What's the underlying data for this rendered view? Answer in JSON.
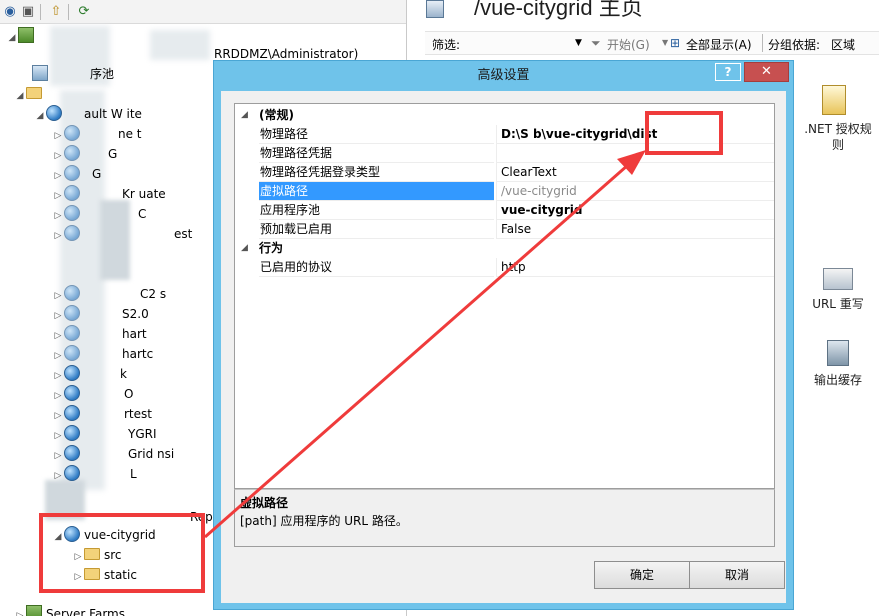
{
  "left_tree": {
    "connection_label": "RRDDMZ\\Administrator)",
    "app_pools_label": "序池",
    "default_site_label": "ault W      ite",
    "fragments": [
      "ne     t",
      "G",
      "Kr      uate",
      "C",
      "est",
      "C2      s",
      "S2.0",
      "hart",
      "hartc",
      "k",
      "O",
      "rtest",
      "YGRI",
      "Grid   nsi",
      "L"
    ],
    "selected_site": "vue-citygrid",
    "children": [
      "src",
      "static"
    ],
    "below_label": "Server Farms",
    "tail_label": "Rep"
  },
  "right_pane": {
    "title": "/vue-citygrid 主页",
    "filter_label": "筛选:",
    "start_button": "开始(G)",
    "show_all_button": "全部显示(A)",
    "group_by_label": "分组依据:",
    "group_by_value": "区域",
    "features": [
      {
        "label": ".NET 授权规则",
        "icon": "lock-document-icon"
      },
      {
        "label": "URL 重写",
        "icon": "url-rewrite-icon"
      },
      {
        "label": "输出缓存",
        "icon": "output-cache-icon"
      }
    ]
  },
  "dialog": {
    "title": "高级设置",
    "help_label": "?",
    "close_label": "✕",
    "categories": [
      {
        "name": "(常规)",
        "properties": [
          {
            "name": "物理路径",
            "value": "D:\\S          b\\vue-citygrid\\dist",
            "style": "bold"
          },
          {
            "name": "物理路径凭据",
            "value": "",
            "style": "normal"
          },
          {
            "name": "物理路径凭据登录类型",
            "value": "ClearText",
            "style": "normal"
          },
          {
            "name": "虚拟路径",
            "value": "/vue-citygrid",
            "style": "dim",
            "selected": true
          },
          {
            "name": "应用程序池",
            "value": "vue-citygrid",
            "style": "bold"
          },
          {
            "name": "预加载已启用",
            "value": "False",
            "style": "normal"
          }
        ]
      },
      {
        "name": "行为",
        "properties": [
          {
            "name": "已启用的协议",
            "value": "http",
            "style": "normal"
          }
        ]
      }
    ],
    "description_title": "虚拟路径",
    "description_text": "[path] 应用程序的 URL 路径。",
    "ok_label": "确定",
    "cancel_label": "取消"
  },
  "annotation": {
    "color": "#ef3b3b",
    "highlight_text": "\\dist"
  }
}
